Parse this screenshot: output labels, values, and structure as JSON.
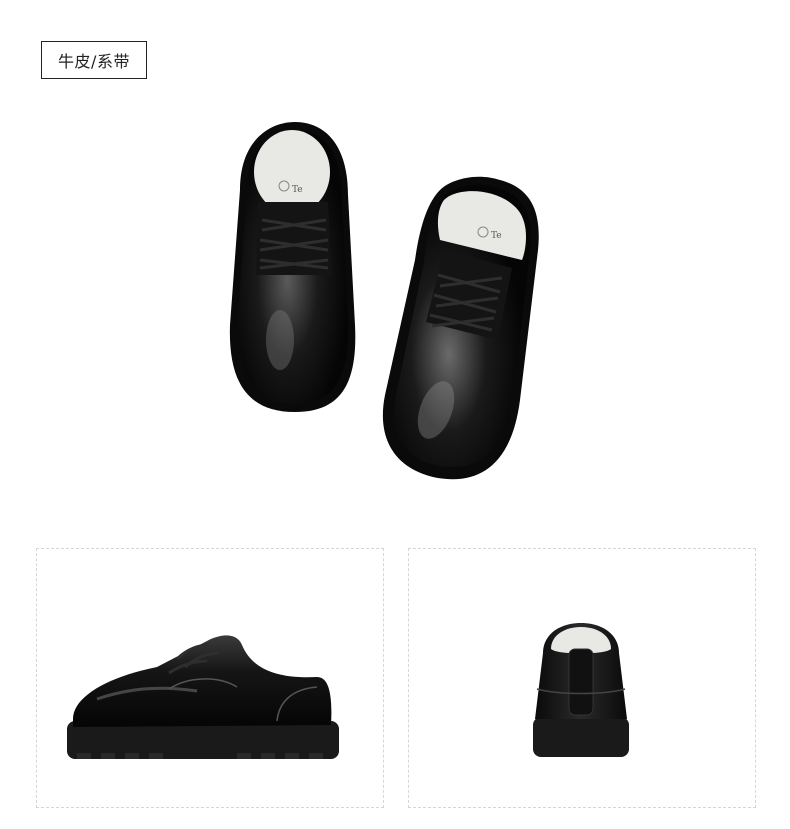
{
  "tag": {
    "label": "牛皮/系带"
  },
  "brand": {
    "insole_mark": "Te"
  },
  "colors": {
    "leather": "#0d0d0d",
    "lining": "#e8e8e4",
    "sole": "#1a1a1a",
    "border": "#222222"
  },
  "images": [
    {
      "name": "pair-top-view"
    },
    {
      "name": "side-view"
    },
    {
      "name": "back-view"
    }
  ]
}
